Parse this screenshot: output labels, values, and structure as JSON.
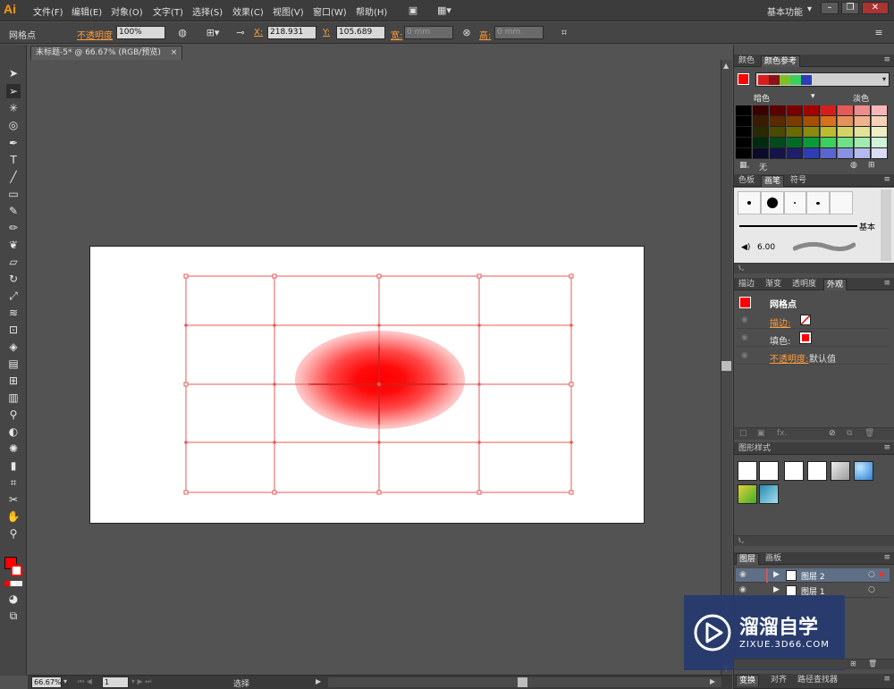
{
  "app": {
    "logo": "Ai",
    "menu": [
      "文件(F)",
      "编辑(E)",
      "对象(O)",
      "文字(T)",
      "选择(S)",
      "效果(C)",
      "视图(V)",
      "窗口(W)",
      "帮助(H)"
    ],
    "workspace": "基本功能",
    "workspace_arrow": "▾",
    "win_buttons": [
      "–",
      "❐",
      "✕"
    ]
  },
  "controlbar": {
    "object_type": "网格点",
    "opacity_label": "不透明度",
    "opacity_value": "100%",
    "x_label": "X:",
    "x_value": "218.931",
    "y_label": "Y:",
    "y_value": "105.689",
    "w_label": "宽:",
    "w_value": "0 mm",
    "h_label": "高:",
    "h_value": "0 mm"
  },
  "document": {
    "tab_title": "未标题-5* @ 66.67% (RGB/预览)",
    "tab_close": "×"
  },
  "statusbar": {
    "zoom": "66.67%",
    "page": "1",
    "tool_status": "选择"
  },
  "color_guide_panel": {
    "tabs": [
      "颜色",
      "颜色参考"
    ],
    "dark_label": "暗色",
    "light_label": "淡色",
    "none_label": "无",
    "harmony_colors": [
      "#d71d1d",
      "#8a1414",
      "#7fbf2a",
      "#3ad05c",
      "#2f3db5"
    ]
  },
  "brushes_panel": {
    "tabs": [
      "色板",
      "画笔",
      "符号"
    ],
    "basic_label": "基本",
    "size_label": "6.00"
  },
  "appearance_panel": {
    "tabs": [
      "描边",
      "渐变",
      "透明度",
      "外观"
    ],
    "title": "网格点",
    "rows": [
      {
        "label": "描边:"
      },
      {
        "label": "填色:"
      },
      {
        "label": "不透明度:",
        "value": "默认值"
      }
    ]
  },
  "graphic_styles_panel": {
    "tabs": [
      "图形样式"
    ]
  },
  "layers_panel": {
    "tabs": [
      "图层",
      "画板"
    ],
    "layers": [
      {
        "name": "图层 2",
        "color": "#d9534f"
      },
      {
        "name": "图层 1",
        "color": "#4a6fd6"
      }
    ]
  },
  "bottom_panel_tabs": [
    "变换",
    "对齐",
    "路径查找器"
  ],
  "watermark": {
    "title": "溜溜自学",
    "url": "ZIXUE.3D66.COM"
  },
  "colors": {
    "fill": "#ff0000",
    "accent_orange": "#ff9c3c",
    "mesh_line": "#e85a5a"
  }
}
